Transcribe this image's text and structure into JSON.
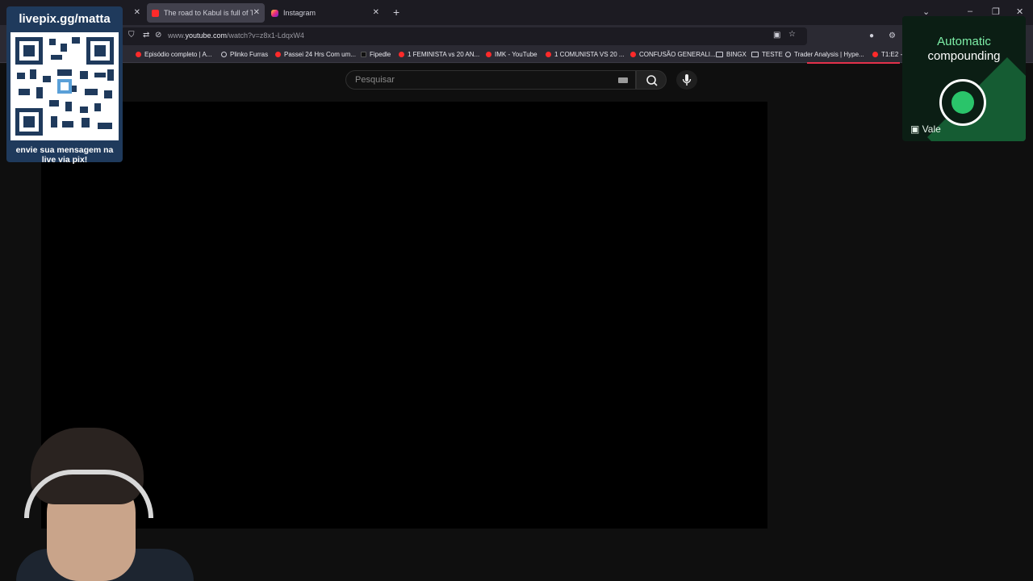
{
  "tabs": [
    {
      "title": "",
      "active": false
    },
    {
      "title": "The road to Kabul is full of Talil",
      "active": true
    },
    {
      "title": "Instagram",
      "active": false
    }
  ],
  "address": {
    "prefix": "www.",
    "domain": "youtube.com",
    "path": "/watch?v=z8x1-LdqxW4"
  },
  "bookmarks": [
    {
      "label": "Episódio completo | A...",
      "icon": "youtube"
    },
    {
      "label": "Plinko Furras",
      "icon": "globe"
    },
    {
      "label": "Passei 24 Hrs Com um...",
      "icon": "youtube"
    },
    {
      "label": "Fipedle",
      "icon": "dark"
    },
    {
      "label": "1 FEMINISTA vs 20 AN...",
      "icon": "youtube"
    },
    {
      "label": "IMK - YouTube",
      "icon": "youtube"
    },
    {
      "label": "1 COMUNISTA VS 20 ...",
      "icon": "youtube"
    },
    {
      "label": "CONFUSÃO GENERALI...",
      "icon": "youtube"
    },
    {
      "label": "BINGX",
      "icon": "folder"
    },
    {
      "label": "TESTE",
      "icon": "folder"
    },
    {
      "label": "Trader Analysis | Hype...",
      "icon": "globe"
    },
    {
      "label": "T1:E2 -",
      "icon": "youtube"
    }
  ],
  "youtube": {
    "search_placeholder": "Pesquisar"
  },
  "pix_overlay": {
    "title": "livepix.gg/matta",
    "footer_line1": "envie sua mensagem na",
    "footer_line2": "live via pix!"
  },
  "ad": {
    "line1": "Automatic",
    "line2": "compounding",
    "brand": "Vale"
  },
  "colors": {
    "accent": "#e3314b",
    "ad_green": "#2ac46a"
  }
}
